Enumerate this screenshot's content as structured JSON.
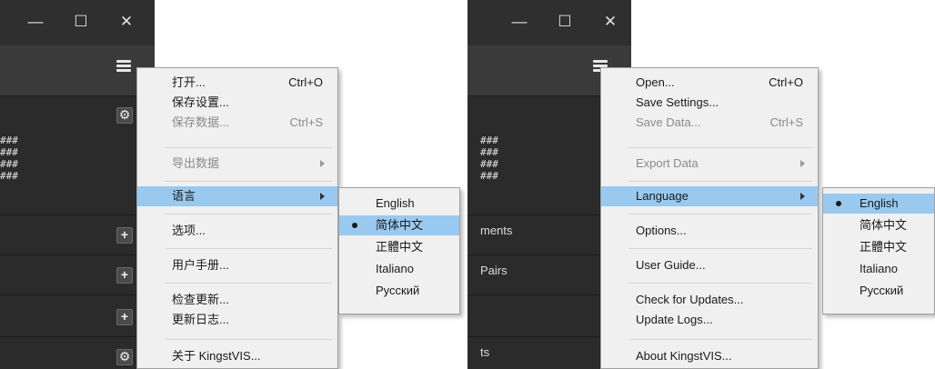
{
  "window_controls": {
    "minimize": "—",
    "maximize": "☐",
    "close": "✕"
  },
  "left": {
    "hash_lines": [
      "###",
      "###",
      "###",
      "###"
    ],
    "menu": [
      {
        "label": "打开...",
        "shortcut": "Ctrl+O",
        "disabled": false
      },
      {
        "label": "保存设置...",
        "shortcut": "",
        "disabled": false
      },
      {
        "label": "保存数据...",
        "shortcut": "Ctrl+S",
        "disabled": true
      },
      {
        "label": "导出数据",
        "shortcut": "",
        "disabled": true
      },
      {
        "label": "语言",
        "shortcut": "",
        "disabled": false
      },
      {
        "label": "选项...",
        "shortcut": "",
        "disabled": false
      },
      {
        "label": "用户手册...",
        "shortcut": "",
        "disabled": false
      },
      {
        "label": "检查更新...",
        "shortcut": "",
        "disabled": false
      },
      {
        "label": "更新日志...",
        "shortcut": "",
        "disabled": false
      },
      {
        "label": "关于 KingstVIS...",
        "shortcut": "",
        "disabled": false
      }
    ],
    "languages": [
      "English",
      "简体中文",
      "正體中文",
      "Italiano",
      "Русский"
    ],
    "selected_language": "简体中文"
  },
  "right": {
    "hash_lines": [
      "###",
      "###",
      "###",
      "###"
    ],
    "row_labels": [
      "ments",
      "Pairs",
      "ts"
    ],
    "menu": [
      {
        "label": "Open...",
        "shortcut": "Ctrl+O",
        "disabled": false
      },
      {
        "label": "Save Settings...",
        "shortcut": "",
        "disabled": false
      },
      {
        "label": "Save Data...",
        "shortcut": "Ctrl+S",
        "disabled": true
      },
      {
        "label": "Export Data",
        "shortcut": "",
        "disabled": true
      },
      {
        "label": "Language",
        "shortcut": "",
        "disabled": false
      },
      {
        "label": "Options...",
        "shortcut": "",
        "disabled": false
      },
      {
        "label": "User Guide...",
        "shortcut": "",
        "disabled": false
      },
      {
        "label": "Check for Updates...",
        "shortcut": "",
        "disabled": false
      },
      {
        "label": "Update Logs...",
        "shortcut": "",
        "disabled": false
      },
      {
        "label": "About KingstVIS...",
        "shortcut": "",
        "disabled": false
      }
    ],
    "languages": [
      "English",
      "简体中文",
      "正體中文",
      "Italiano",
      "Русский"
    ],
    "selected_language": "English"
  },
  "colors": {
    "highlight": "#99c9ef",
    "menu_bg": "#f0f0f0",
    "app_bg": "#2b2b2b"
  }
}
